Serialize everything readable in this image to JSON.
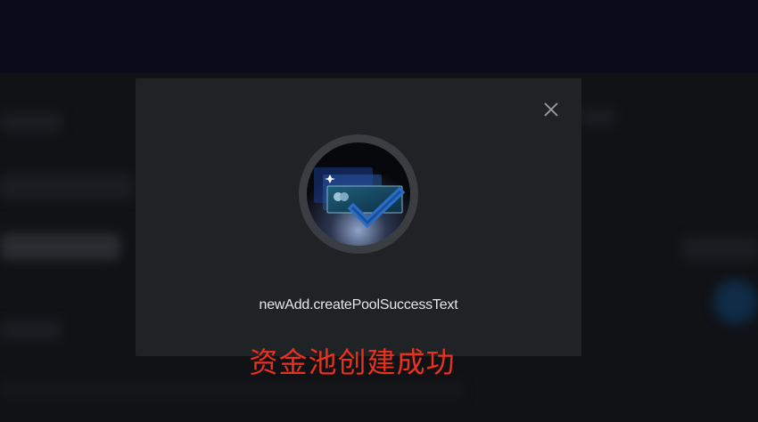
{
  "modal": {
    "close_icon": "close-icon",
    "illustration_icon": "pool-success-check-icon",
    "success_text": "newAdd.createPoolSuccessText"
  },
  "caption": {
    "text": "资金池创建成功",
    "color": "#e8321e"
  }
}
